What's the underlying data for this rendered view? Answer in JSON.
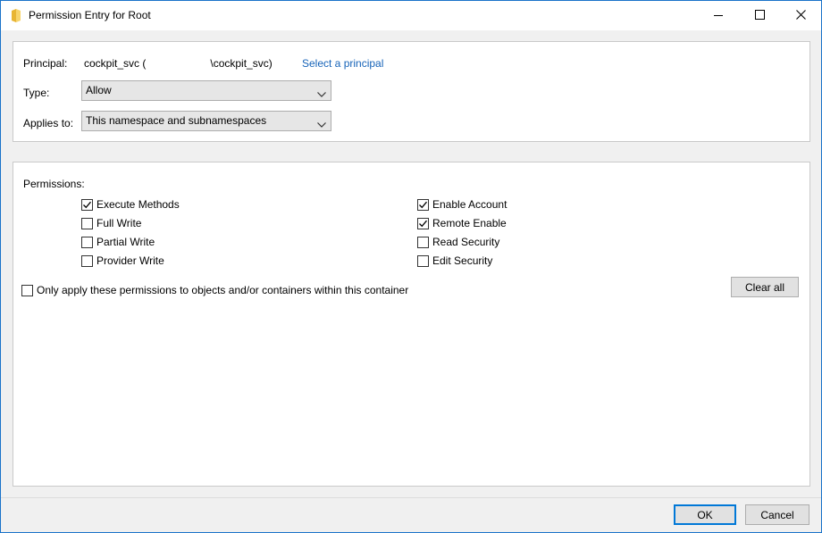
{
  "window": {
    "title": "Permission Entry for Root",
    "title_icon": "folder-icon",
    "controls": [
      "minimize-icon",
      "maximize-icon",
      "close-icon"
    ]
  },
  "principal": {
    "label": "Principal:",
    "value_prefix": "cockpit_svc (",
    "value_suffix": "\\cockpit_svc)",
    "select_link": "Select a principal"
  },
  "type": {
    "label": "Type:",
    "selected": "Allow"
  },
  "applies_to": {
    "label": "Applies to:",
    "selected": "This namespace and subnamespaces"
  },
  "permissions": {
    "label": "Permissions:",
    "left": [
      {
        "label": "Execute Methods",
        "checked": true
      },
      {
        "label": "Full Write",
        "checked": false
      },
      {
        "label": "Partial Write",
        "checked": false
      },
      {
        "label": "Provider Write",
        "checked": false
      }
    ],
    "right": [
      {
        "label": "Enable Account",
        "checked": true
      },
      {
        "label": "Remote Enable",
        "checked": true
      },
      {
        "label": "Read Security",
        "checked": false
      },
      {
        "label": "Edit Security",
        "checked": false
      }
    ],
    "only_apply": {
      "label": "Only apply these permissions to objects and/or containers within this container",
      "checked": false
    },
    "clear_all": "Clear all"
  },
  "footer": {
    "ok": "OK",
    "cancel": "Cancel"
  },
  "colors": {
    "accent": "#0078d7",
    "link": "#1663b8",
    "window_border": "#1a73c9"
  }
}
